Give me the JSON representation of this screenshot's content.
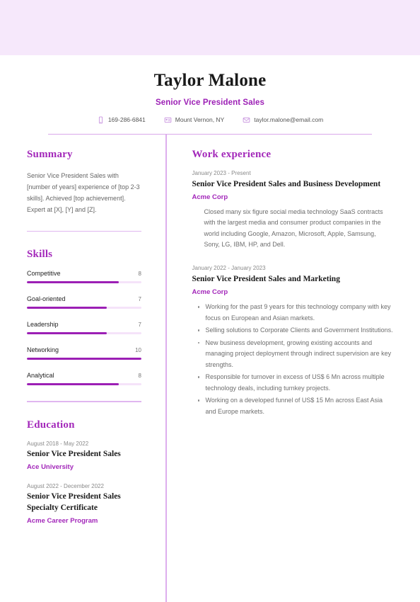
{
  "banner": {
    "color": "#f6e8fb"
  },
  "accent": {
    "primary": "#a328ba",
    "bar": "#9c1fb5",
    "track": "#f5e3f9",
    "rule": "#e0b7f0"
  },
  "header": {
    "full_name": "Taylor Malone",
    "job_title": "Senior Vice President Sales",
    "contacts": [
      {
        "icon": "phone-icon",
        "value": "169-286-6841"
      },
      {
        "icon": "location-icon",
        "value": "Mount Vernon, NY"
      },
      {
        "icon": "email-icon",
        "value": "taylor.malone@email.com"
      }
    ]
  },
  "summary": {
    "heading": "Summary",
    "text": "Senior Vice President Sales with [number of years] experience of [top 2-3 skills]. Achieved [top achievement]. Expert at [X], [Y] and [Z]."
  },
  "skills": {
    "heading": "Skills",
    "max": 10,
    "items": [
      {
        "name": "Competitive",
        "value": 8
      },
      {
        "name": "Goal-oriented",
        "value": 7
      },
      {
        "name": "Leadership",
        "value": 7
      },
      {
        "name": "Networking",
        "value": 10
      },
      {
        "name": "Analytical",
        "value": 8
      }
    ]
  },
  "education": {
    "heading": "Education",
    "items": [
      {
        "date": "August 2018 - May 2022",
        "title": "Senior Vice President Sales",
        "org": "Ace University"
      },
      {
        "date": "August 2022 - December 2022",
        "title": "Senior Vice President Sales Specialty Certificate",
        "org": "Acme Career Program"
      }
    ]
  },
  "work_experience": {
    "heading": "Work experience",
    "items": [
      {
        "date": "January 2023 - Present",
        "title": "Senior Vice President Sales and Business Development",
        "org": "Acme Corp",
        "description": "Closed many six figure social media technology SaaS contracts with the largest media and consumer product companies in the world including Google, Amazon, Microsoft, Apple, Samsung, Sony, LG, IBM, HP, and Dell.",
        "bullets": []
      },
      {
        "date": "January 2022 - January 2023",
        "title": "Senior Vice President Sales and Marketing",
        "org": "Acme Corp",
        "description": "",
        "bullets": [
          "Working for the past 9 years for this technology company with key focus on European and Asian markets.",
          "Selling solutions to Corporate Clients and Government Institutions.",
          "New business development, growing existing accounts and managing project deployment through indirect supervision are key strengths.",
          "Responsible for turnover in excess of US$ 6 Mn across multiple technology deals, including turnkey projects.",
          "Working on a developed funnel of US$ 15 Mn across East Asia and Europe markets."
        ]
      }
    ]
  }
}
